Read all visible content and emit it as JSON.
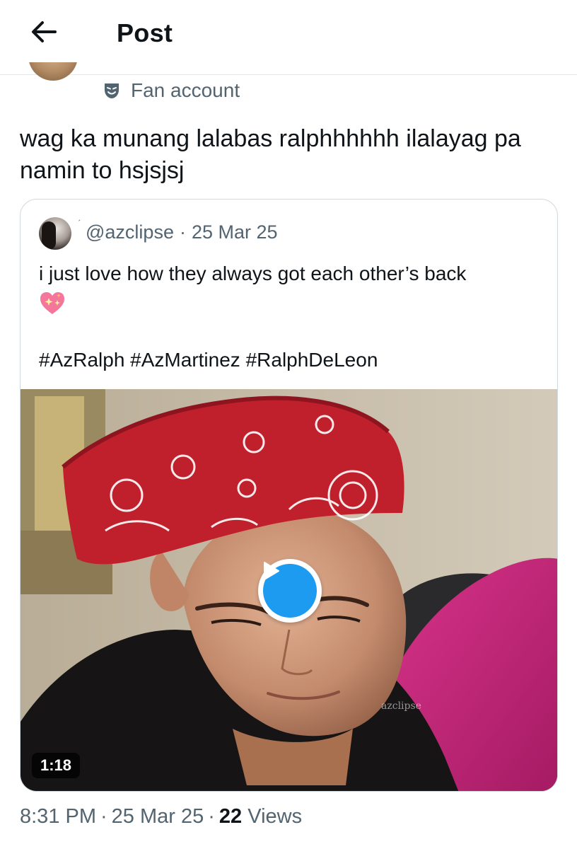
{
  "header": {
    "back_icon": "arrow-left-icon",
    "title": "Post"
  },
  "author": {
    "badge_icon": "theater-mask-icon",
    "badge_label": "Fan account"
  },
  "post": {
    "text": "wag ka munang lalabas ralphhhhhh ilalayag pa namin to hsjsjsj"
  },
  "quoted_post": {
    "handle": "@azclipse",
    "separator": "·",
    "date": "25 Mar 25",
    "text": "i just love how they always got each other’s back",
    "emoji": "sparkling-heart-icon",
    "hashtags": "#AzRalph #AzMartinez #RalphDeLeon",
    "media": {
      "type": "video",
      "duration": "1:18",
      "watermark": "azclipse",
      "play_icon": "play-icon"
    }
  },
  "footer": {
    "time": "8:31 PM",
    "separator": "·",
    "date": "25 Mar 25",
    "views_count": "22",
    "views_label": "Views"
  },
  "colors": {
    "text_primary": "#0f1419",
    "text_secondary": "#536471",
    "border": "#cfd9de",
    "accent": "#1d9bf0",
    "bandana_red": "#c0202c"
  }
}
